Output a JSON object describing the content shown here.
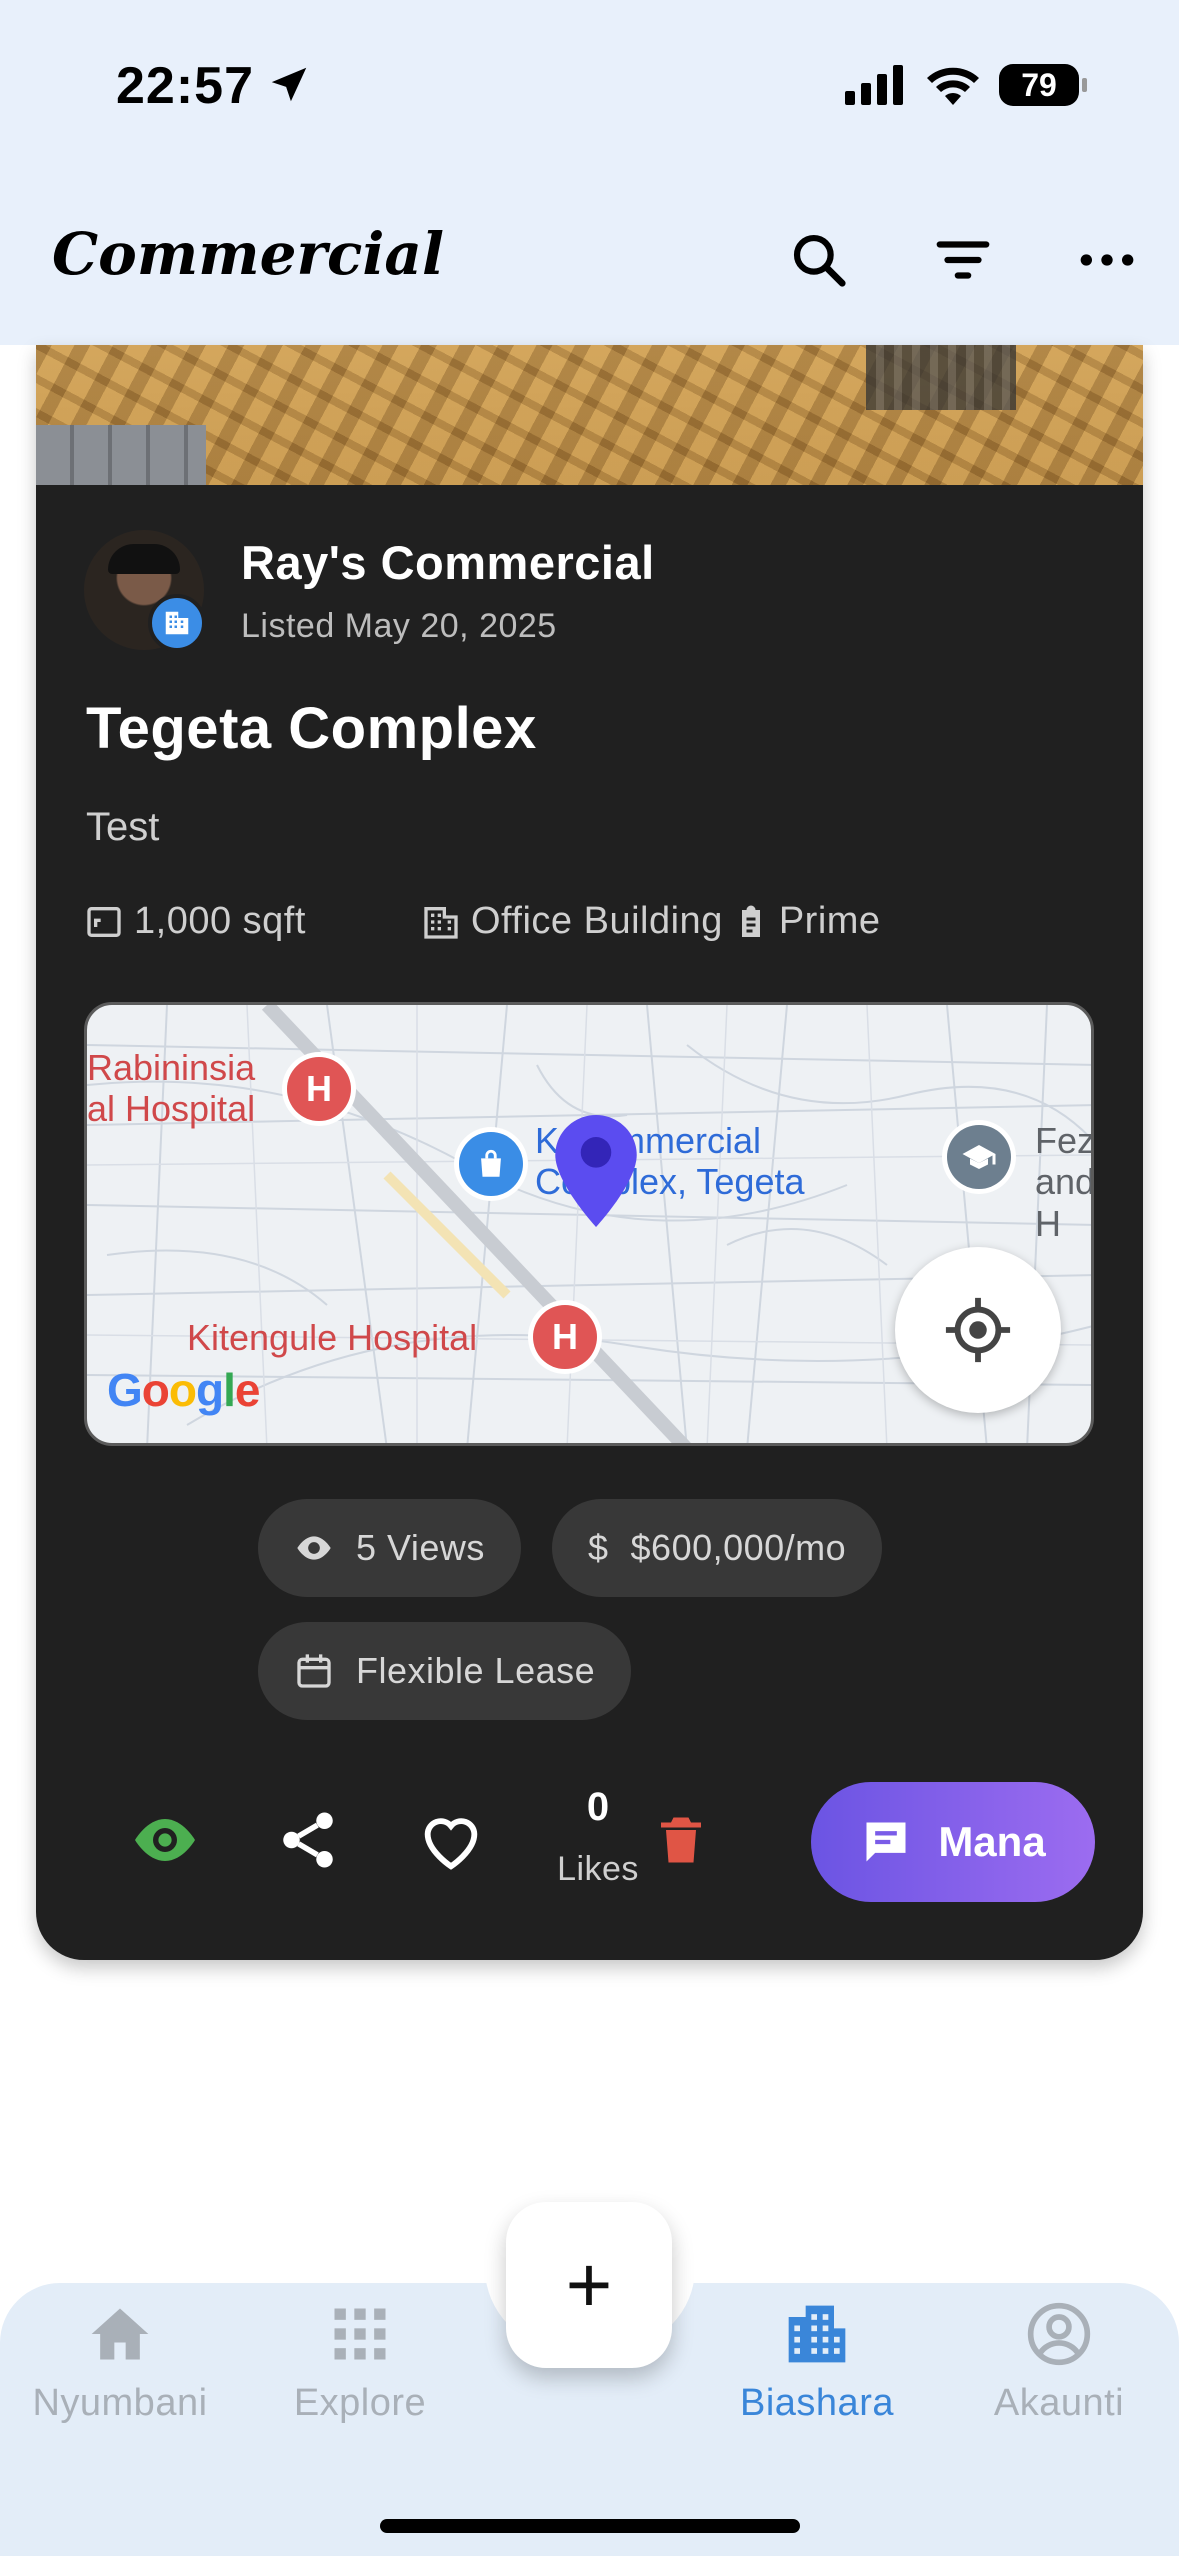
{
  "status_bar": {
    "time": "22:57",
    "battery": "79"
  },
  "app_bar": {
    "title": "Commercial",
    "icons": [
      "search-icon",
      "filter-icon",
      "more-icon"
    ]
  },
  "listing": {
    "owner_name": "Ray's Commercial",
    "listed_date": "Listed May 20, 2025",
    "title": "Tegeta Complex",
    "description": "Test",
    "area": "1,000 sqft",
    "property_type": "Office Building",
    "grade": "Prime",
    "views": "5 Views",
    "price": "$600,000/mo",
    "price_symbol": "$",
    "lease": "Flexible Lease",
    "likes_count": "0",
    "likes_label": "Likes",
    "chat_button": "Mana"
  },
  "map": {
    "labels": {
      "hospital_1": "Rabininsia\nal Hospital",
      "complex": "K  Commercial\nComplex, Tegeta",
      "school": "Feza\nand H",
      "hospital_2": "Kitengule Hospital",
      "brand": "Google"
    },
    "poi_hospital_letter": "H"
  },
  "bottom_nav": {
    "items": [
      {
        "label": "Nyumbani",
        "icon": "home-icon",
        "active": false
      },
      {
        "label": "Explore",
        "icon": "grid-icon",
        "active": false
      },
      {
        "label": "Biashara",
        "icon": "business-icon",
        "active": true
      },
      {
        "label": "Akaunti",
        "icon": "account-icon",
        "active": false
      }
    ],
    "fab_label": "+"
  },
  "colors": {
    "accent": "#3a86d9",
    "card": "#202020",
    "chat_gradient_start": "#6b54e3",
    "chat_gradient_end": "#9c6cf0",
    "delete": "#e05545",
    "seen": "#4caf50"
  }
}
